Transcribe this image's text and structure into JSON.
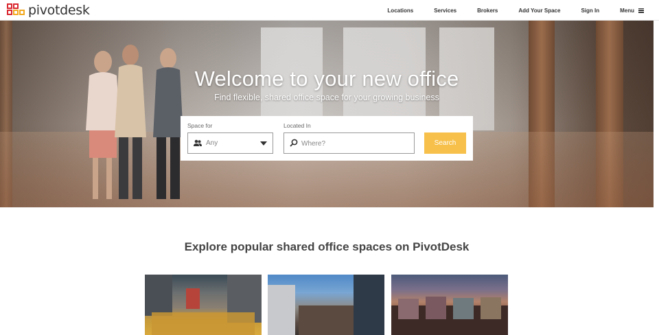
{
  "brand": {
    "logo_text": "pivotdesk"
  },
  "nav": {
    "items": [
      "Locations",
      "Services",
      "Brokers",
      "Add Your Space",
      "Sign In"
    ],
    "menu_label": "Menu"
  },
  "hero": {
    "title": "Welcome to your new office",
    "subtitle": "Find flexible, shared office space for your growing business"
  },
  "search": {
    "space_for_label": "Space for",
    "space_for_value": "Any",
    "located_in_label": "Located In",
    "located_in_placeholder": "Where?",
    "button_label": "Search",
    "button_color": "#f7c04a"
  },
  "explore": {
    "title": "Explore popular shared office spaces on PivotDesk"
  },
  "icons": {
    "logo": "pivotdesk-logo-icon",
    "menu": "hamburger-icon",
    "space_for": "users-icon",
    "dropdown": "caret-down-icon",
    "located_in": "search-icon"
  }
}
